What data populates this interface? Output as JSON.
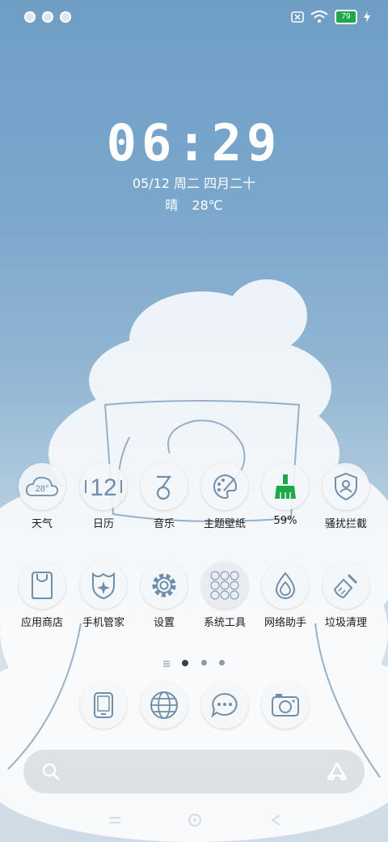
{
  "status_bar": {
    "notification_icons": [
      "app-notification-icon",
      "app-notification-icon",
      "app-notification-icon"
    ],
    "sim_icon": "no-sim-icon",
    "wifi_icon": "wifi-icon",
    "battery_level": "79",
    "charging_icon": "charging-bolt-icon"
  },
  "clock": {
    "time": "06:29"
  },
  "date": {
    "text": "05/12 周二 四月二十"
  },
  "weather": {
    "condition": "晴",
    "temperature": "28℃"
  },
  "apps_row1": [
    {
      "label": "天气",
      "icon": "weather-icon",
      "badge": "28°"
    },
    {
      "label": "日历",
      "icon": "calendar-icon",
      "badge": "12"
    },
    {
      "label": "音乐",
      "icon": "music-icon"
    },
    {
      "label": "主题壁纸",
      "icon": "palette-icon"
    },
    {
      "label": "59%",
      "icon": "broom-icon"
    },
    {
      "label": "骚扰拦截",
      "icon": "shield-icon"
    }
  ],
  "apps_row2": [
    {
      "label": "应用商店",
      "icon": "store-bag-icon"
    },
    {
      "label": "手机管家",
      "icon": "phone-manager-icon"
    },
    {
      "label": "设置",
      "icon": "gear-icon"
    },
    {
      "label": "系统工具",
      "icon": "folder-grid-icon"
    },
    {
      "label": "网络助手",
      "icon": "water-drop-icon"
    },
    {
      "label": "垃圾清理",
      "icon": "brush-icon"
    }
  ],
  "dock": [
    {
      "icon": "phone-tablet-icon"
    },
    {
      "icon": "browser-globe-icon"
    },
    {
      "icon": "messages-icon"
    },
    {
      "icon": "camera-icon"
    }
  ],
  "page_indicator": {
    "total": 3,
    "active": 1
  },
  "search": {
    "icon": "search-icon",
    "assistant_icon": "assistant-icon"
  },
  "colors": {
    "accent_green": "#1fa84a",
    "icon_stroke": "#6e8eab"
  }
}
